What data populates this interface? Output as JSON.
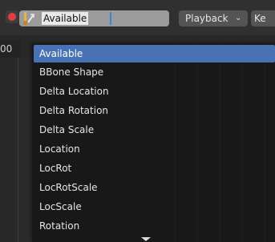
{
  "header": {
    "record_icon": "record-dot-icon",
    "keyset_icon": "keying-set-icon",
    "keyset_value": "Available",
    "playback_label": "Playback",
    "playback_chevron": "⌄",
    "keying_label": "Ke"
  },
  "timeline": {
    "frame_label": "00"
  },
  "dropdown": {
    "items": [
      {
        "label": "Available"
      },
      {
        "label": "BBone Shape"
      },
      {
        "label": "Delta Location"
      },
      {
        "label": "Delta Rotation"
      },
      {
        "label": "Delta Scale"
      },
      {
        "label": "Location"
      },
      {
        "label": "LocRot"
      },
      {
        "label": "LocRotScale"
      },
      {
        "label": "LocScale"
      },
      {
        "label": "Rotation"
      }
    ],
    "active_index": 0,
    "scroll_icon": "scroll-down-arrow-icon"
  },
  "colors": {
    "accent": "#4772b3",
    "record": "#e13f3f",
    "caret": "#3a86d6"
  }
}
